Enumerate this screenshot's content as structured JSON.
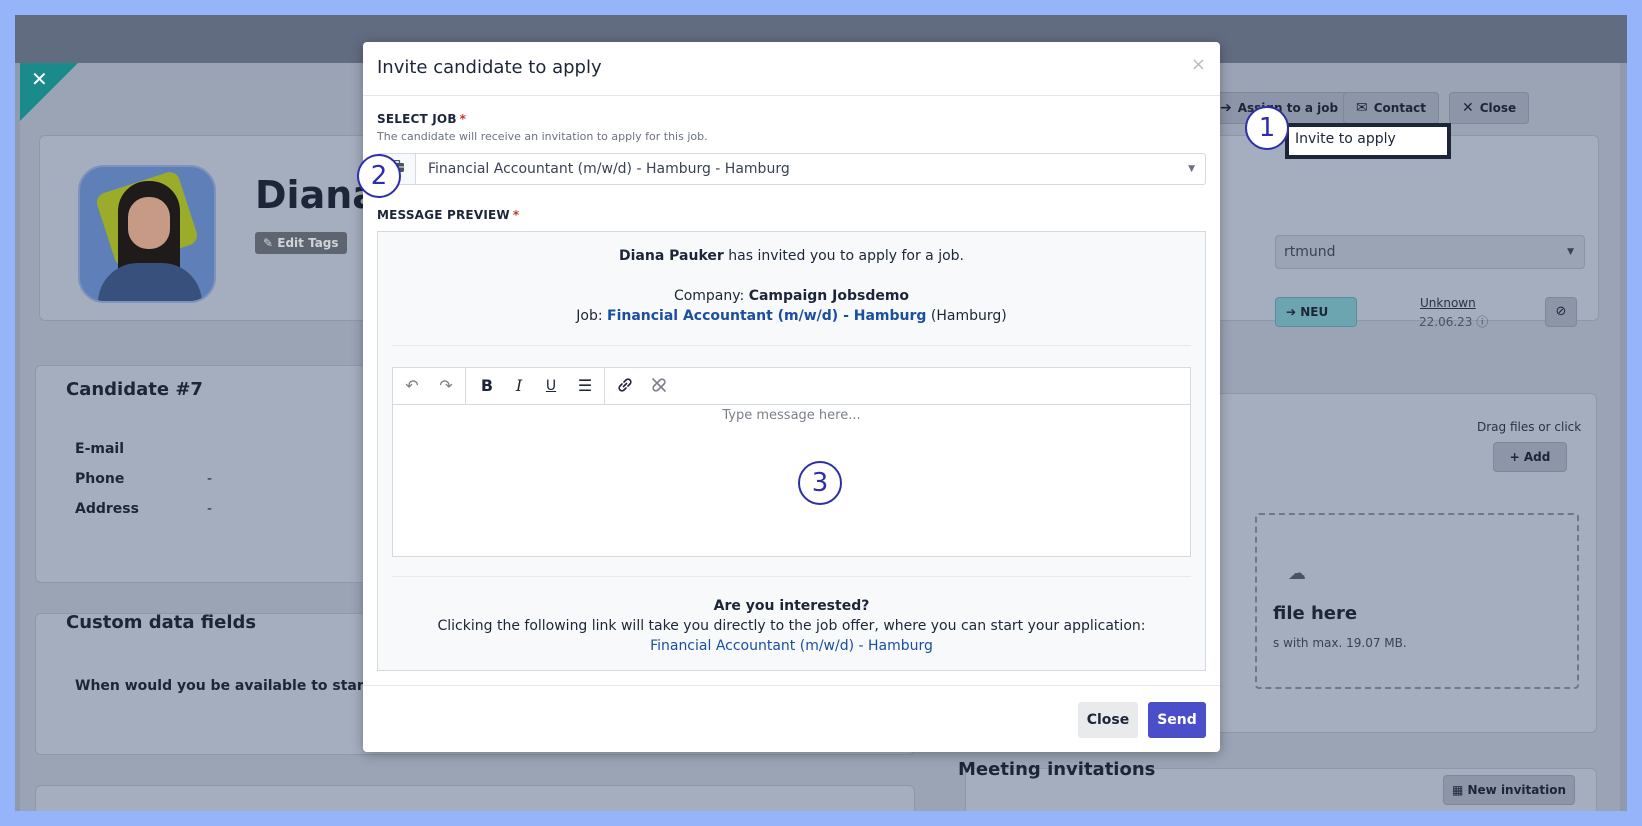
{
  "background": {
    "candidate_name": "Diana I",
    "edit_tags": "Edit Tags",
    "header_buttons": {
      "assign": "Assign to a job",
      "contact": "Contact",
      "close": "Close"
    },
    "dropdown_item": "Invite to apply",
    "location_select": "rtmund",
    "status_button": "NEU",
    "source_label": "Unknown",
    "source_date": "22.06.23",
    "candidate_card": {
      "title": "Candidate #7",
      "fields": [
        {
          "label": "E-mail",
          "value": ""
        },
        {
          "label": "Phone",
          "value": "-"
        },
        {
          "label": "Address",
          "value": "-"
        }
      ]
    },
    "custom_card": {
      "title": "Custom data fields",
      "question": "When would you be available to start?"
    },
    "files": {
      "drag_hint": "Drag files or click",
      "add_button": "Add",
      "drop_title": "file here",
      "drop_sub": "s with max. 19.07 MB."
    },
    "meetings": {
      "title": "Meeting invitations",
      "new_button": "New invitation"
    }
  },
  "modal": {
    "title": "Invite candidate to apply",
    "close_x": "×",
    "select_job": {
      "label": "SELECT JOB",
      "required": "*",
      "help": "The candidate will receive an invitation to apply for this job.",
      "value": "Financial Accountant (m/w/d) - Hamburg - Hamburg"
    },
    "message_preview": {
      "label": "MESSAGE PREVIEW",
      "required": "*",
      "inviter_name": "Diana Pauker",
      "inviter_text": " has invited you to apply for a job.",
      "company_label": "Company: ",
      "company_name": "Campaign Jobsdemo",
      "job_label": "Job: ",
      "job_link": "Financial Accountant (m/w/d) - Hamburg",
      "job_location": " (Hamburg)",
      "editor_placeholder": "Type message here...",
      "interest_title": "Are you interested?",
      "interest_text": "Clicking the following link will take you directly to the job offer, where you can start your application:",
      "interest_link": "Financial Accountant (m/w/d) - Hamburg"
    },
    "buttons": {
      "close": "Close",
      "send": "Send"
    }
  },
  "markers": [
    "1",
    "2",
    "3"
  ],
  "colors": {
    "primary": "#4a4fc9",
    "link": "#1a4fa0",
    "marker": "#2e2fa8",
    "frame": "#95b4f9"
  }
}
